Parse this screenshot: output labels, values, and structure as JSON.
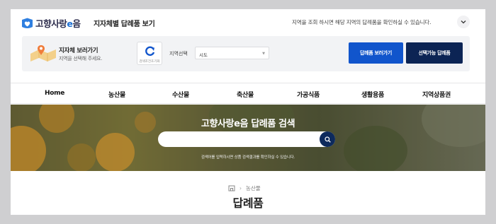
{
  "header": {
    "logo_text_a": "고향사랑",
    "logo_text_e": "e",
    "logo_text_b": "음",
    "page_heading": "지자체별 답례품 보기",
    "notice": "지역을 조회 하시면 해당 지역의 답례품을 확인하실 수 있습니다."
  },
  "filter": {
    "title": "지자체 보러가기",
    "subtitle": "지역을 선택해 주세요.",
    "reset_label": "검색조건초기화",
    "region_label": "지역선택",
    "region_value": "시도",
    "btn_gifts": "답례품 보러가기",
    "btn_selectable": "선택가능 답례품"
  },
  "nav": {
    "items": [
      "Home",
      "농산물",
      "수산물",
      "축산물",
      "가공식품",
      "생활용품",
      "지역상품권"
    ]
  },
  "hero": {
    "title": "고향사랑e음 답례품 검색",
    "search_placeholder": "",
    "hint": "검색어를 입력하시면 상품 검색결과를 확인하실 수 있습니다."
  },
  "content": {
    "breadcrumb_current": "농산물",
    "title": "답례품"
  },
  "colors": {
    "primary_blue": "#1155cc",
    "navy": "#0c2454",
    "brand_blue": "#1b6fd4"
  }
}
